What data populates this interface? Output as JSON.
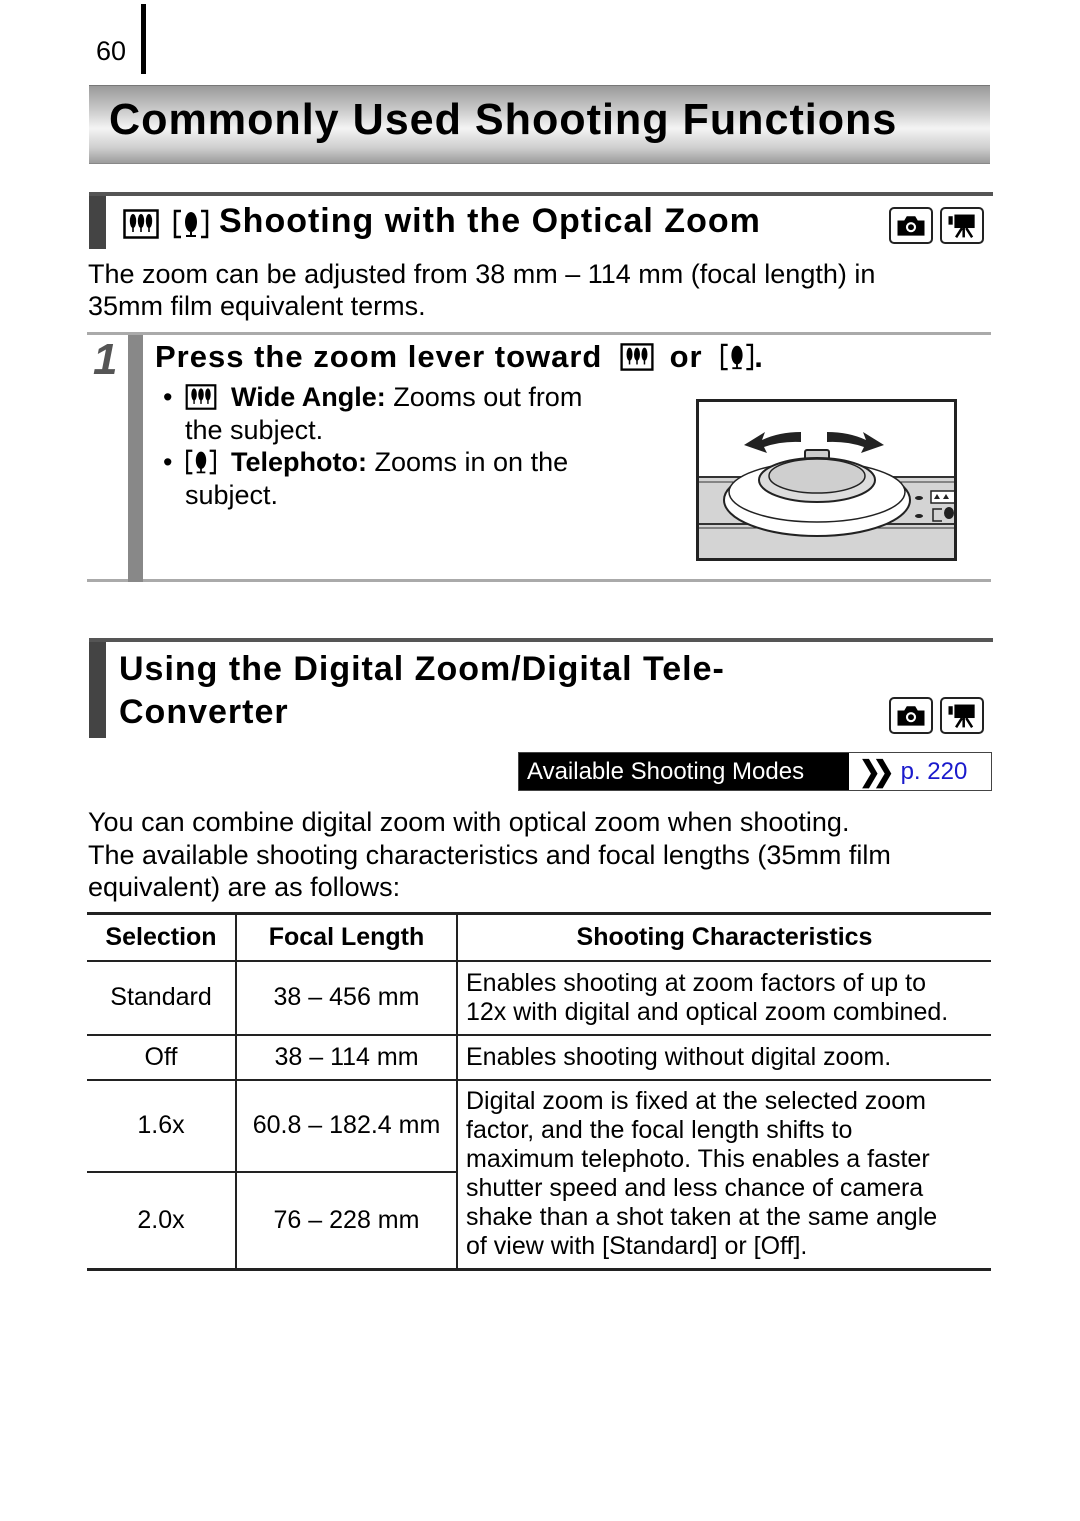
{
  "page": {
    "number": "60",
    "chapter_title": "Commonly Used Shooting Functions"
  },
  "optical_zoom": {
    "title": "Shooting with the Optical Zoom",
    "title_icons": [
      "wide-angle-icon",
      "telephoto-icon"
    ],
    "mode_icons": [
      "still-camera-icon",
      "movie-camera-icon"
    ],
    "intro_lines": [
      "The zoom can be adjusted from 38 mm – 114 mm (focal length) in",
      "35mm film equivalent terms."
    ],
    "step": {
      "number": "1",
      "title_prefix": "Press the zoom lever toward",
      "title_or": "or",
      "title_suffix": ".",
      "bullets": [
        {
          "icon": "wide-angle-icon",
          "label": "Wide Angle:",
          "text_line1": "Zooms out from",
          "text_line2": "the subject."
        },
        {
          "icon": "telephoto-icon",
          "label": "Telephoto:",
          "text_line1": "Zooms in on the",
          "text_line2": "subject."
        }
      ],
      "illustration": "zoom-lever-illustration"
    }
  },
  "digital_zoom": {
    "title_line1": "Using the Digital Zoom/Digital Tele-",
    "title_line2": "Converter",
    "mode_icons": [
      "still-camera-icon",
      "movie-camera-icon"
    ],
    "modes_box": {
      "label": "Available Shooting Modes",
      "link_icon": "double-chevron-right-icon",
      "link": "p. 220",
      "link_color": "#1a1acc"
    },
    "intro_lines": [
      "You can combine digital zoom with optical zoom when shooting.",
      "The available shooting characteristics and focal lengths (35mm film",
      "equivalent) are as follows:"
    ],
    "table": {
      "headers": [
        "Selection",
        "Focal Length",
        "Shooting Characteristics"
      ],
      "rows": [
        {
          "selection": "Standard",
          "focal": "38 – 456 mm",
          "desc_lines": [
            "Enables shooting at zoom factors of up to",
            "12x with digital and optical zoom combined."
          ]
        },
        {
          "selection": "Off",
          "focal": "38 – 114 mm",
          "desc_lines": [
            "Enables shooting without digital zoom."
          ]
        },
        {
          "selection": "1.6x",
          "focal": "60.8 – 182.4 mm"
        },
        {
          "selection": "2.0x",
          "focal": "76 – 228 mm"
        }
      ],
      "shared_desc_lines": [
        "Digital zoom is fixed at the selected zoom",
        "factor, and the focal length shifts to",
        "maximum telephoto. This enables a faster",
        "shutter speed and less chance of camera",
        "shake than a shot taken at the same angle",
        "of view with [Standard] or [Off]."
      ]
    }
  }
}
